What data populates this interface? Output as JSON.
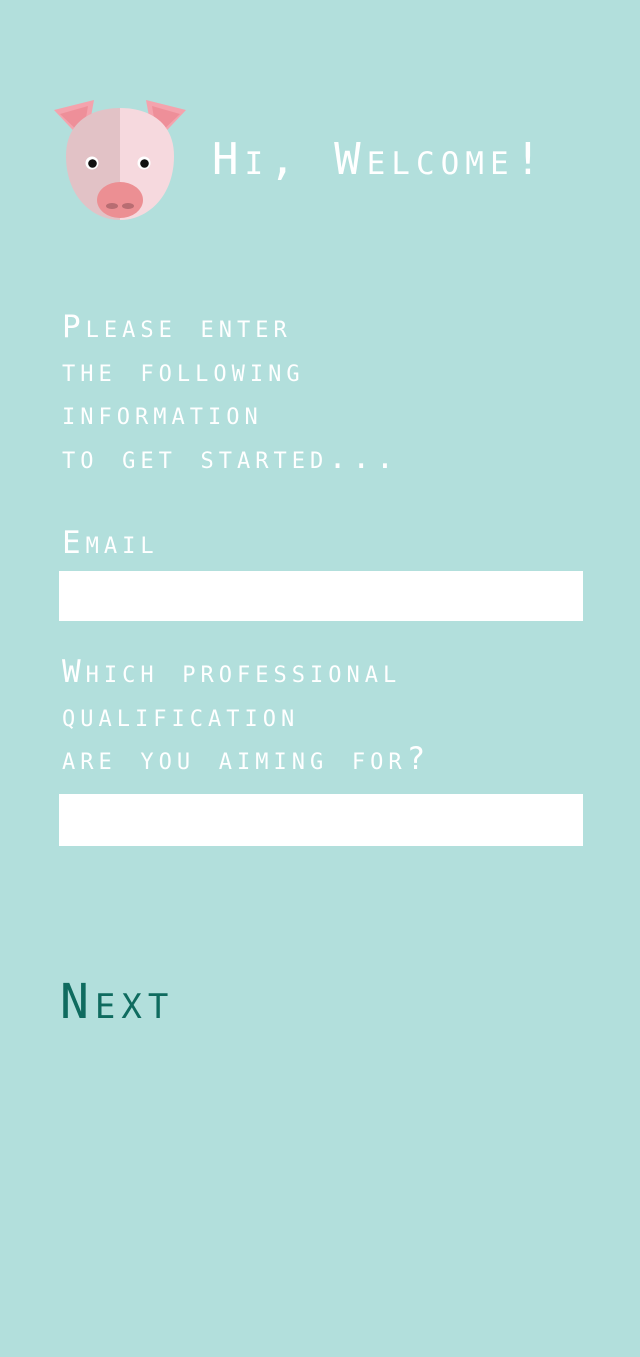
{
  "header": {
    "title": "Hi, Welcome!",
    "logo_icon": "pig-icon"
  },
  "intro": {
    "lines": [
      "Please enter",
      "the following",
      "information",
      "to get started..."
    ]
  },
  "form": {
    "email": {
      "label": "Email",
      "value": "",
      "placeholder": ""
    },
    "qualification": {
      "label_lines": [
        "Which professional",
        "qualification",
        "are you aiming for?"
      ],
      "value": "",
      "placeholder": ""
    }
  },
  "actions": {
    "next_label": "Next"
  },
  "colors": {
    "background": "#b2dfdc",
    "text": "#ffffff",
    "accent": "#0f6b5f",
    "pig_face": "#f6d9de",
    "pig_shade": "#e2c2c6",
    "pig_ear": "#f4a3ad",
    "pig_snout": "#ec8f93"
  }
}
